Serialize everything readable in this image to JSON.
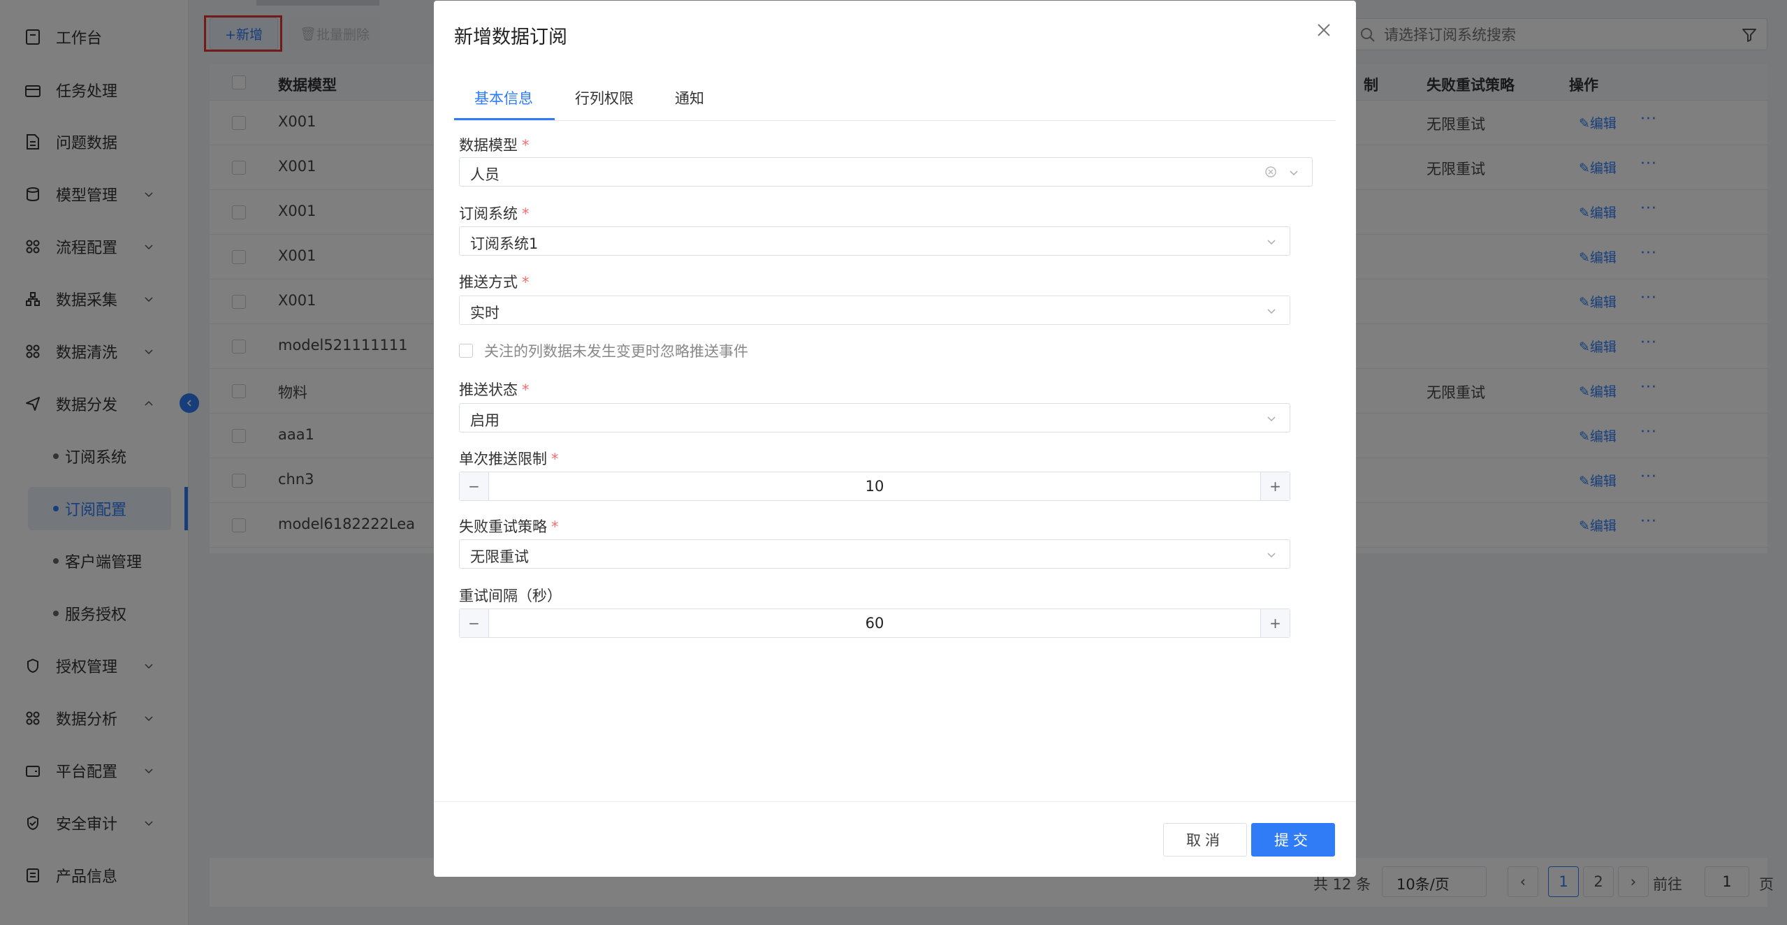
{
  "sidebar": {
    "items": [
      {
        "label": "工作台",
        "icon": "clipboard-icon"
      },
      {
        "label": "任务处理",
        "icon": "box-icon"
      },
      {
        "label": "问题数据",
        "icon": "document-icon"
      },
      {
        "label": "模型管理",
        "icon": "database-icon"
      },
      {
        "label": "流程配置",
        "icon": "grid-icon"
      },
      {
        "label": "数据采集",
        "icon": "hierarchy-icon"
      },
      {
        "label": "数据清洗",
        "icon": "grid-icon"
      },
      {
        "label": "数据分发",
        "icon": "send-icon"
      },
      {
        "label": "订阅系统"
      },
      {
        "label": "订阅配置"
      },
      {
        "label": "客户端管理"
      },
      {
        "label": "服务授权"
      },
      {
        "label": "授权管理",
        "icon": "shield-icon"
      },
      {
        "label": "数据分析",
        "icon": "grid-icon"
      },
      {
        "label": "平台配置",
        "icon": "wallet-icon"
      },
      {
        "label": "安全审计",
        "icon": "shield-check-icon"
      },
      {
        "label": "产品信息",
        "icon": "list-icon"
      }
    ]
  },
  "toolbar": {
    "add_label": "+新增",
    "batch_delete_label": "批量删除",
    "search_placeholder": "请选择订阅系统搜索"
  },
  "table": {
    "headers": {
      "model": "数据模型",
      "limit": "制",
      "retry": "失败重试策略",
      "action": "操作"
    },
    "rows": [
      {
        "model": "X001",
        "retry": "无限重试"
      },
      {
        "model": "X001",
        "retry": "无限重试"
      },
      {
        "model": "X001",
        "retry": ""
      },
      {
        "model": "X001",
        "retry": ""
      },
      {
        "model": "X001",
        "retry": ""
      },
      {
        "model": "model521111111",
        "retry": ""
      },
      {
        "model": "物料",
        "retry": "无限重试"
      },
      {
        "model": "aaa1",
        "retry": ""
      },
      {
        "model": "chn3",
        "retry": ""
      },
      {
        "model": "model6182222Lea",
        "retry": ""
      }
    ],
    "edit_label": "编辑",
    "more_label": "···"
  },
  "pager": {
    "total": "共 12 条",
    "page_size": "10条/页",
    "pages": [
      "1",
      "2"
    ],
    "goto": "前往",
    "goto_value": "1",
    "page_suffix": "页"
  },
  "modal": {
    "title": "新增数据订阅",
    "tabs": [
      "基本信息",
      "行列权限",
      "通知"
    ],
    "fields": {
      "model": {
        "label": "数据模型",
        "value": "人员"
      },
      "system": {
        "label": "订阅系统",
        "value": "订阅系统1"
      },
      "push_mode": {
        "label": "推送方式",
        "value": "实时"
      },
      "ignore_check": {
        "label": "关注的列数据未发生变更时忽略推送事件"
      },
      "push_status": {
        "label": "推送状态",
        "value": "启用"
      },
      "single_limit": {
        "label": "单次推送限制",
        "value": "10"
      },
      "retry_policy": {
        "label": "失败重试策略",
        "value": "无限重试"
      },
      "retry_interval": {
        "label": "重试间隔（秒）",
        "value": "60"
      }
    },
    "required_mark": "*",
    "cancel_label": "取消",
    "submit_label": "提交"
  },
  "colors": {
    "accent": "#2f7cf6",
    "required": "#f56c6c",
    "highlight": "#e53935"
  }
}
